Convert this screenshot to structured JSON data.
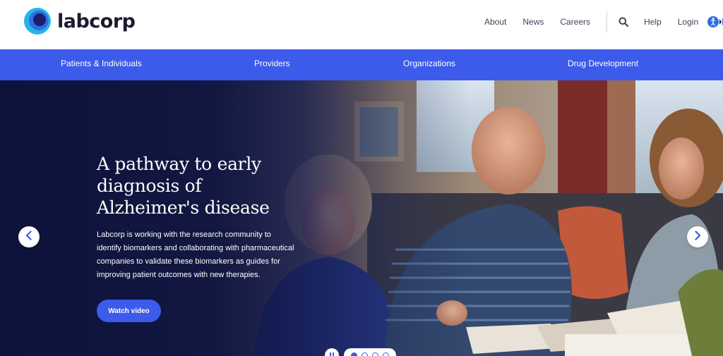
{
  "brand": {
    "name": "labcorp",
    "color": "#3c5bea"
  },
  "utility_nav": {
    "about": "About",
    "news": "News",
    "careers": "Careers",
    "search_icon": "search-icon",
    "help": "Help",
    "login": "Login",
    "accessibility_icon": "accessibility-icon"
  },
  "main_nav": {
    "items": [
      {
        "label": "Patients & Individuals"
      },
      {
        "label": "Providers"
      },
      {
        "label": "Organizations"
      },
      {
        "label": "Drug Development"
      }
    ]
  },
  "hero": {
    "title": "A pathway to early diagnosis of Alzheimer's disease",
    "body": "Labcorp is working with the research community to identify biomarkers and collaborating with pharmaceutical companies to validate these biomarkers as guides for improving patient outcomes with new therapies.",
    "cta_label": "Watch video",
    "prev_icon": "chevron-left-icon",
    "next_icon": "chevron-right-icon",
    "pause_icon": "pause-icon",
    "slides_total": 4,
    "active_slide": 1
  }
}
